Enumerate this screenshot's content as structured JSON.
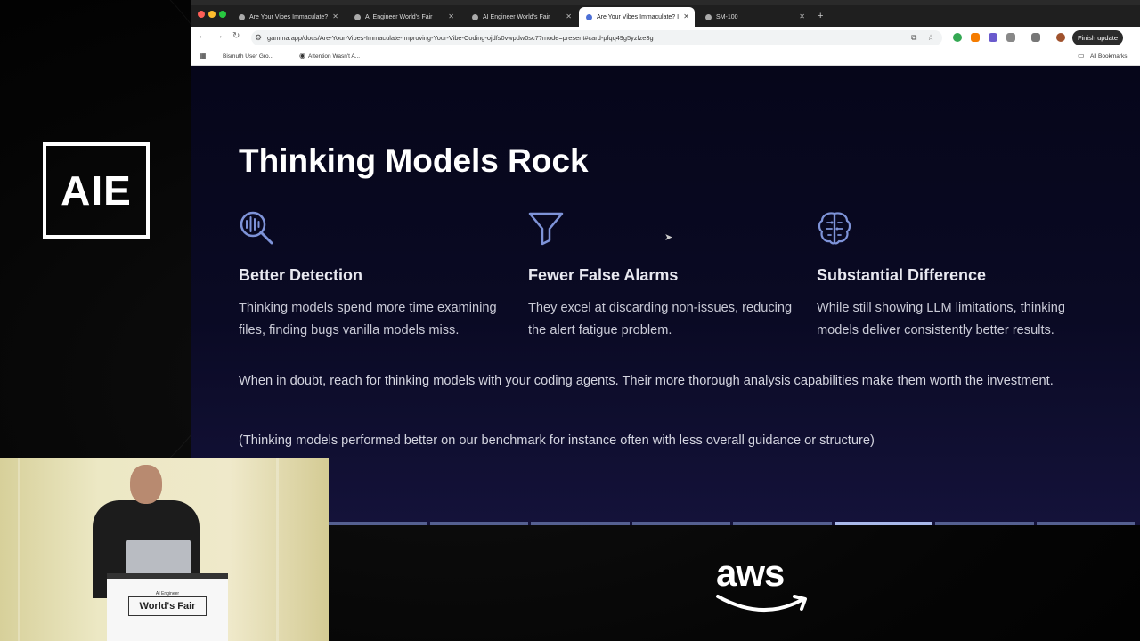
{
  "browser": {
    "tabs": [
      {
        "label": "Are Your Vibes Immaculate?",
        "active": false
      },
      {
        "label": "AI Engineer World's Fair",
        "active": false
      },
      {
        "label": "AI Engineer World's Fair",
        "active": false
      },
      {
        "label": "Are Your Vibes Immaculate? I",
        "active": true
      },
      {
        "label": "SM-100",
        "active": false
      }
    ],
    "url": "gamma.app/docs/Are-Your-Vibes-Immaculate-Improving-Your-Vibe-Coding-ojdfs0vwpdw0sc7?mode=present#card-pfqq49g5yzfze3g",
    "finish_update": "Finish update",
    "bookmarks": [
      "Bismuth User Gro...",
      "Attention Wasn't A..."
    ],
    "all_bookmarks": "All Bookmarks"
  },
  "slide": {
    "title": "Thinking Models Rock",
    "features": [
      {
        "icon": "voice-search-icon",
        "heading": "Better Detection",
        "text": "Thinking models spend more time examining files, finding bugs vanilla models miss."
      },
      {
        "icon": "funnel-icon",
        "heading": "Fewer False Alarms",
        "text": "They excel at discarding non-issues, reducing the alert fatigue problem."
      },
      {
        "icon": "brain-icon",
        "heading": "Substantial Difference",
        "text": "While still showing LLM limitations, thinking models deliver consistently better results."
      }
    ],
    "paragraph_1": "When in doubt, reach for thinking models with your coding agents. Their more thorough analysis capabilities make them worth the investment.",
    "paragraph_2": "(Thinking models performed better on our benchmark for instance often with less overall guidance or structure)"
  },
  "overlay": {
    "logo": "AIE",
    "podium_subtitle": "AI Engineer",
    "podium_sign": "World's Fair",
    "sponsor_logo": "aws"
  },
  "colors": {
    "accent_icon": "#7e93d8",
    "slide_bg": "#0a0a24"
  }
}
